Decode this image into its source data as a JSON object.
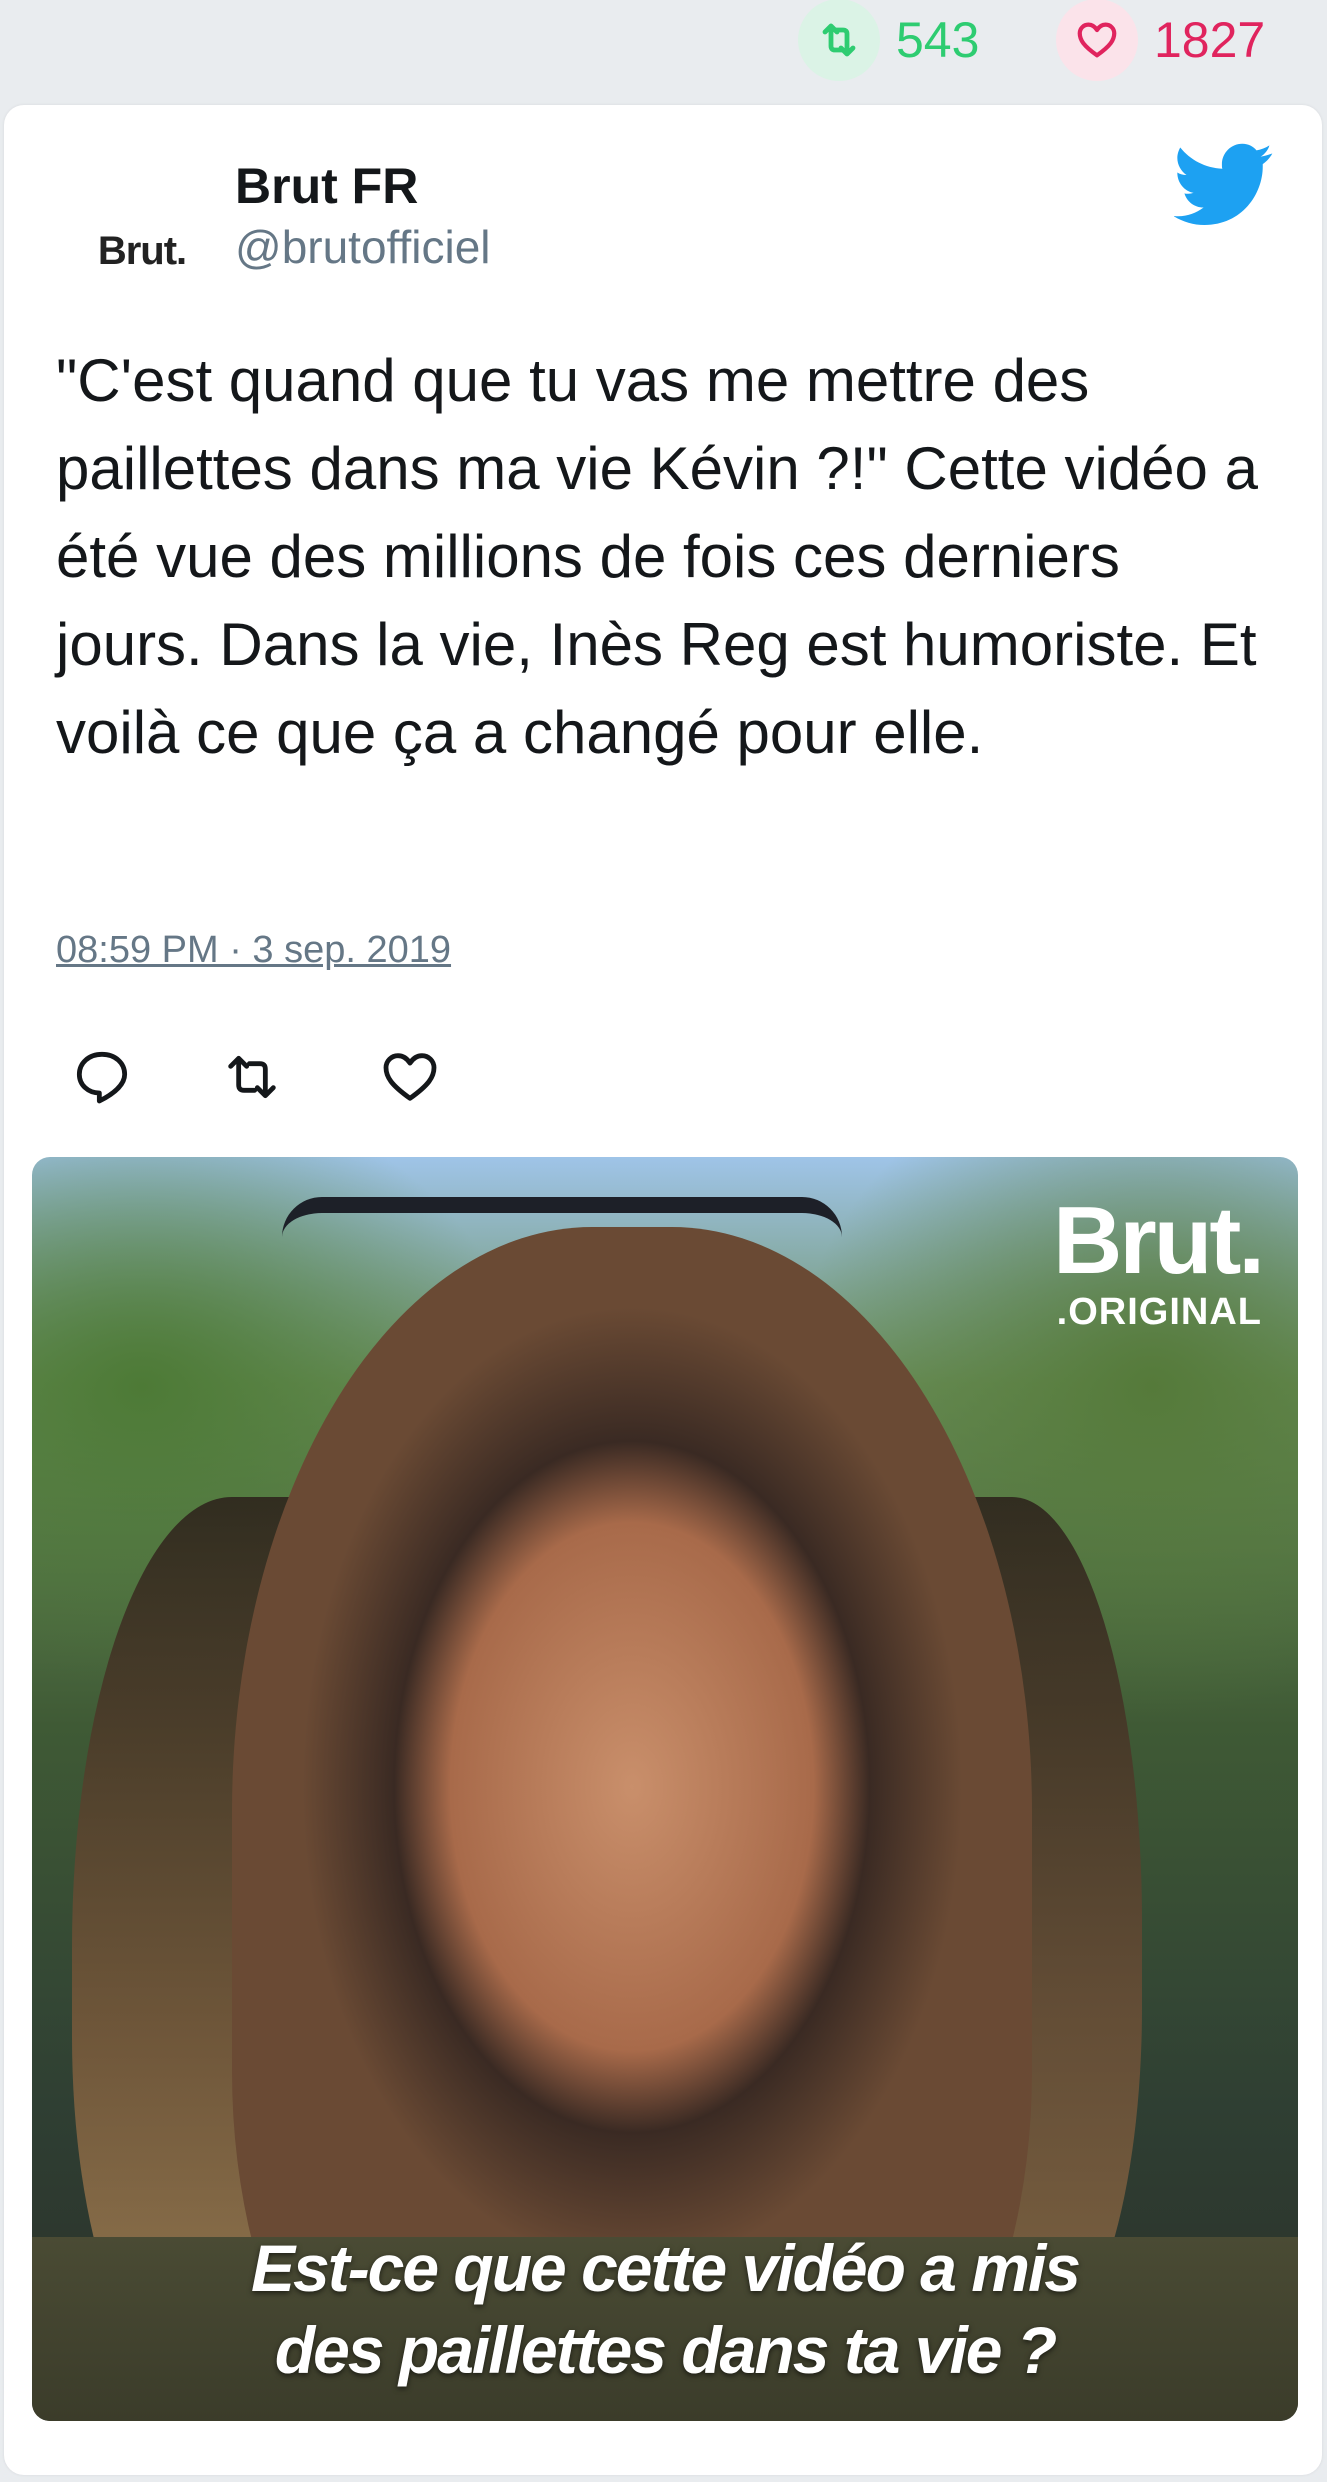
{
  "stats": {
    "retweets": "543",
    "likes": "1827"
  },
  "tweet": {
    "author_name": "Brut FR",
    "author_handle": "@brutofficiel",
    "avatar_text": "Brut.",
    "text": "\"C'est quand que tu vas me mettre des paillettes dans ma vie Kévin ?!\" Cette vidéo a été vue des millions de fois ces derniers jours. Dans la vie, Inès Reg est humoriste. Et voilà ce que ça a changé pour elle.",
    "timestamp": "08:59 PM · 3 sep. 2019"
  },
  "media": {
    "brand_logo": "Brut.",
    "brand_sub": ".ORIGINAL",
    "caption_line1": "Est-ce que cette vidéo a mis",
    "caption_line2": "des paillettes dans ta vie ?"
  },
  "colors": {
    "retweet_green": "#2ecc71",
    "like_red": "#e0245e",
    "twitter_blue": "#1da1f2",
    "muted": "#657786"
  },
  "icons": [
    "retweet-icon",
    "heart-icon",
    "twitter-bird-icon",
    "reply-icon"
  ]
}
